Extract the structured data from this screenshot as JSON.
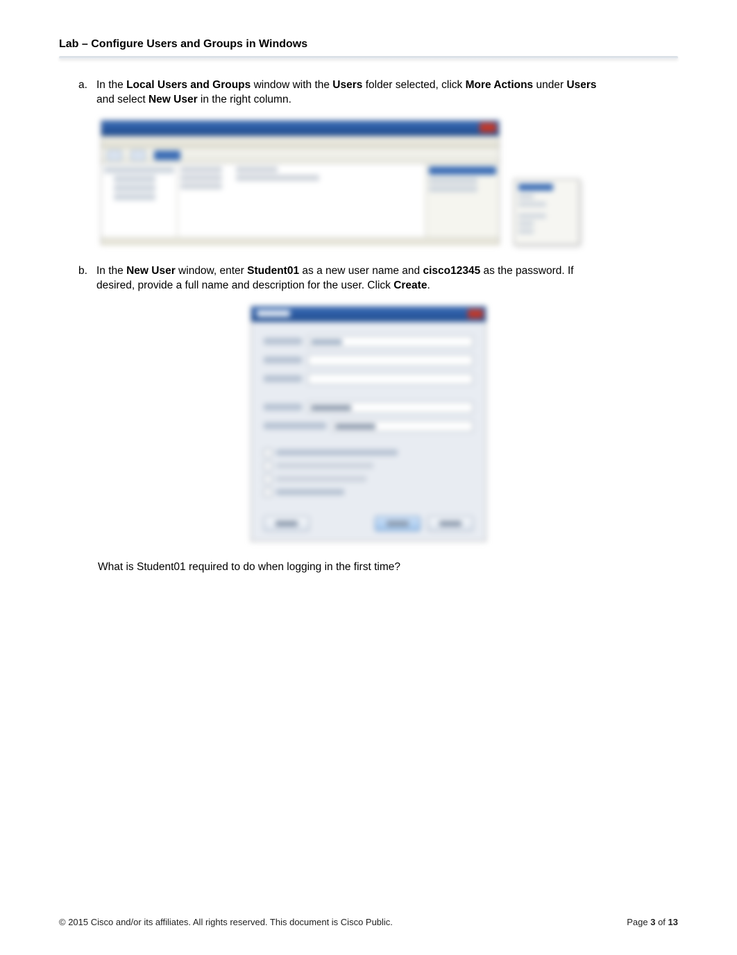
{
  "header": {
    "title": "Lab – Configure Users and Groups in Windows"
  },
  "steps": {
    "a": {
      "marker": "a.",
      "line1_prefix": "In  the ",
      "bold1": "Local Users and Groups",
      "mid1": " window with the ",
      "bold2": "Users",
      "mid2": " folder selected, click ",
      "bold3": "More Actions",
      "mid3": " under ",
      "bold4": "Users",
      "line2_prefix": "and select ",
      "bold5": "New User",
      "line2_suffix": " in the right column."
    },
    "b": {
      "marker": "b.",
      "line1_prefix": "In  the ",
      "bold1": "New User",
      "mid1": " window, enter ",
      "bold2": "Student01",
      "mid2": " as a new user name and ",
      "bold3": "cisco12345",
      "mid3": " as the password. If",
      "line2_prefix": "desired, provide a full name and description for the user. Click ",
      "bold4": "Create",
      "line2_suffix": "."
    }
  },
  "question": "What is Student01 required to do when logging in the first time?",
  "footer": {
    "copyright": "© 2015 Cisco and/or its affiliates. All rights reserved. This document is Cisco Public.",
    "page_prefix": "Page ",
    "page_current": "3",
    "page_of": " of ",
    "page_total": "13"
  }
}
